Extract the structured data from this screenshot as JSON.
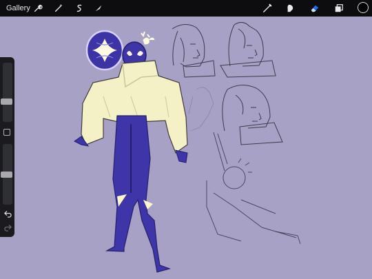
{
  "topbar": {
    "gallery_label": "Gallery",
    "left_tools": [
      {
        "name": "actions-icon"
      },
      {
        "name": "adjustments-icon"
      },
      {
        "name": "selection-icon"
      },
      {
        "name": "transform-icon"
      }
    ],
    "right_tools": [
      {
        "name": "brush-icon"
      },
      {
        "name": "smudge-icon"
      },
      {
        "name": "eraser-icon"
      },
      {
        "name": "layers-icon"
      }
    ],
    "active_tool": "eraser-icon",
    "current_color": "#000000",
    "accent_color": "#1e6cf2"
  },
  "sidebar": {
    "brush_size_level": 0.32,
    "opacity_level": 0.5,
    "undo_icon": "undo-icon",
    "redo_icon": "redo-icon"
  },
  "canvas": {
    "background_color": "#a7a1c6",
    "character_colors": {
      "jacket": "#f4f1c6",
      "suit": "#3e35a8",
      "dark": "#24206b"
    }
  }
}
